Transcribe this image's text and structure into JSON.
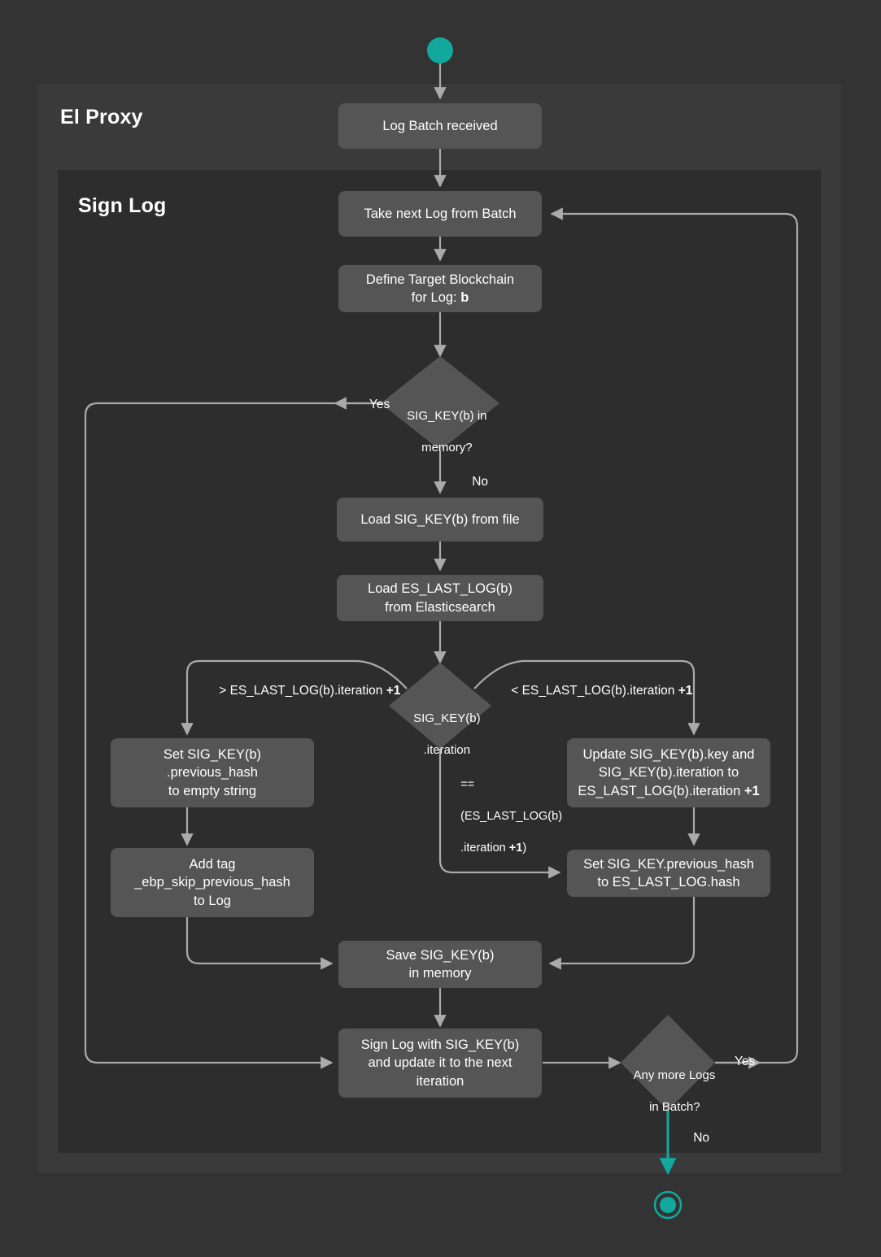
{
  "meta": {
    "title": "El Proxy — Sign Log flowchart",
    "background": "#333333",
    "node_fill": "#555555",
    "outer_group_fill": "#3a3a3a",
    "inner_group_fill": "#2d2d2d",
    "edge_color": "#aaaaaa",
    "accent_color": "#12a89d",
    "text_color": "#ffffff"
  },
  "groups": [
    {
      "id": "el-proxy",
      "label": "El Proxy"
    },
    {
      "id": "sign-log",
      "label": "Sign Log"
    }
  ],
  "nodes": {
    "start": {
      "shape": "circle",
      "label": ""
    },
    "log_batch_received": {
      "shape": "rounded-rect",
      "label": "Log Batch received"
    },
    "take_next_log": {
      "shape": "rounded-rect",
      "label": "Take next Log from Batch"
    },
    "define_target_blockchain": {
      "shape": "rounded-rect",
      "line1": "Define Target Blockchain",
      "line2_pre": "for Log: ",
      "line2_bold": "b"
    },
    "sig_key_in_memory": {
      "shape": "diamond",
      "line1": "SIG_KEY(b) in",
      "line2": "memory?"
    },
    "load_sig_key": {
      "shape": "rounded-rect",
      "label": "Load SIG_KEY(b) from file"
    },
    "load_es_last_log": {
      "shape": "rounded-rect",
      "line1": "Load ES_LAST_LOG(b)",
      "line2": "from Elasticsearch"
    },
    "sig_key_iteration": {
      "shape": "diamond",
      "line1": "SIG_KEY(b)",
      "line2": ".iteration"
    },
    "set_previous_hash_empty": {
      "shape": "rounded-rect",
      "line1": "Set SIG_KEY(b)",
      "line2": ".previous_hash",
      "line3": "to empty string"
    },
    "add_tag_skip_previous_hash": {
      "shape": "rounded-rect",
      "line1": "Add tag",
      "line2": "_ebp_skip_previous_hash",
      "line3": "to Log"
    },
    "update_sig_key": {
      "shape": "rounded-rect",
      "line1": "Update SIG_KEY(b).key and",
      "line2": "SIG_KEY(b).iteration to",
      "line3_pre": "ES_LAST_LOG(b).iteration ",
      "line3_bold": "+1"
    },
    "set_previous_hash_to_es": {
      "shape": "rounded-rect",
      "line1": "Set SIG_KEY.previous_hash",
      "line2": "to ES_LAST_LOG.hash"
    },
    "save_sig_key": {
      "shape": "rounded-rect",
      "line1": "Save SIG_KEY(b)",
      "line2": "in memory"
    },
    "sign_log": {
      "shape": "rounded-rect",
      "line1": "Sign Log with SIG_KEY(b)",
      "line2": "and update it to the next",
      "line3": "iteration"
    },
    "any_more_logs": {
      "shape": "diamond",
      "line1": "Any more Logs",
      "line2": "in Batch?"
    },
    "end": {
      "shape": "double-circle",
      "label": ""
    }
  },
  "edge_labels": {
    "memory_yes": "Yes",
    "memory_no": "No",
    "iteration_greater_pre": "> ES_LAST_LOG(b).iteration ",
    "iteration_greater_bold": "+1",
    "iteration_less_pre": "< ES_LAST_LOG(b).iteration ",
    "iteration_less_bold": "+1",
    "iteration_equal_l1": "==",
    "iteration_equal_l2": "(ES_LAST_LOG(b)",
    "iteration_equal_l3_pre": ".iteration ",
    "iteration_equal_l3_bold": "+1",
    "iteration_equal_l3_post": ")",
    "more_logs_yes": "Yes",
    "more_logs_no": "No"
  }
}
